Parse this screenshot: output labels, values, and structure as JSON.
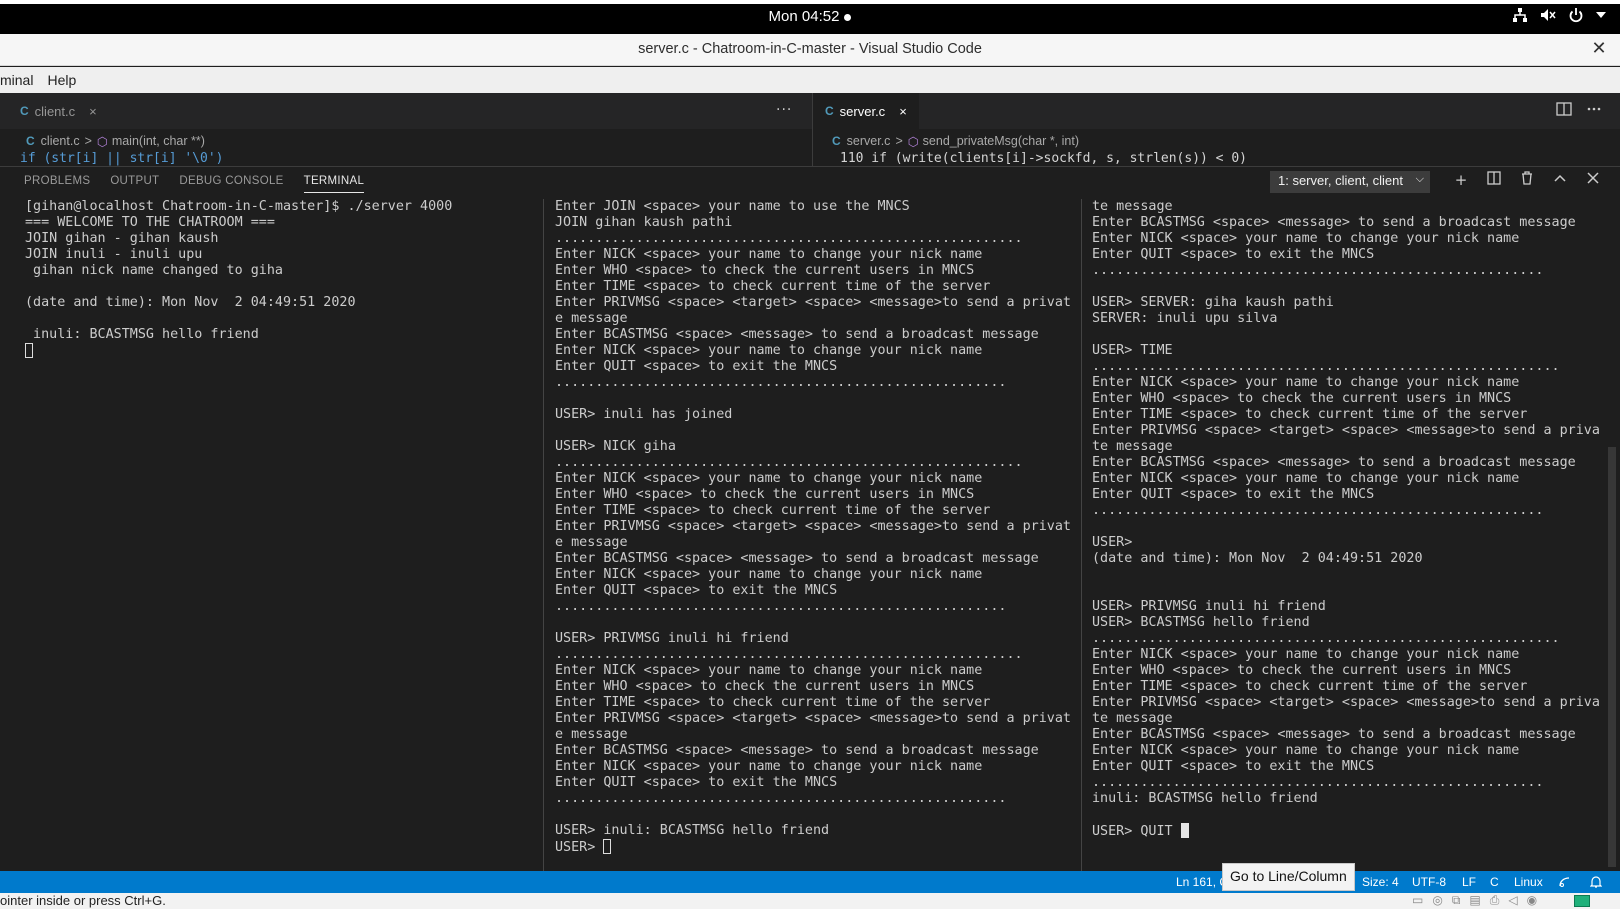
{
  "system": {
    "clock": "Mon 04:52",
    "icons": [
      "network-icon",
      "volume-muted-icon",
      "power-icon",
      "dropdown-arrow-icon"
    ]
  },
  "window": {
    "title": "server.c - Chatroom-in-C-master - Visual Studio Code",
    "close": "✕"
  },
  "menu": [
    "minal",
    "Help"
  ],
  "editors": {
    "left": {
      "tab_label": "client.c",
      "tab_close": "×",
      "more": "···",
      "breadcrumb_file": "client.c",
      "breadcrumb_symbol": "main(int, char **)",
      "peek_line": "       if (str[i]  ||  str[i]    '\\0')"
    },
    "right": {
      "tab_label": "server.c",
      "tab_close": "×",
      "breadcrumb_file": "server.c",
      "breadcrumb_symbol": "send_privateMsg(char *, int)",
      "peek_line": "110                 if (write(clients[i]->sockfd, s, strlen(s)) < 0)"
    },
    "icon_letter": "C",
    "chevron": ">"
  },
  "panel": {
    "tabs": [
      "PROBLEMS",
      "OUTPUT",
      "DEBUG CONSOLE",
      "TERMINAL"
    ],
    "active_tab": "TERMINAL",
    "terminal_select": "1: server, client, client",
    "actions": [
      "plus-icon",
      "split-icon",
      "trash-icon",
      "chevron-up-icon",
      "close-icon"
    ]
  },
  "terminals": {
    "server": [
      "[gihan@localhost Chatroom-in-C-master]$ ./server 4000",
      "=== WELCOME TO THE CHATROOM ===",
      "JOIN gihan - gihan kaush",
      "JOIN inuli - inuli upu",
      " gihan nick name changed to giha",
      "",
      "(date and time): Mon Nov  2 04:49:51 2020",
      "",
      " inuli: BCASTMSG hello friend"
    ],
    "client1": [
      "Enter JOIN <space> your name to use the MNCS",
      "JOIN gihan kaush pathi",
      "..........................................................",
      "Enter NICK <space> your name to change your nick name",
      "Enter WHO <space> to check the current users in MNCS",
      "Enter TIME <space> to check current time of the server",
      "Enter PRIVMSG <space> <target> <space> <message>to send a privat",
      "e message",
      "Enter BCASTMSG <space> <message> to send a broadcast message",
      "Enter NICK <space> your name to change your nick name",
      "Enter QUIT <space> to exit the MNCS",
      "........................................................",
      "",
      "USER> inuli has joined",
      "",
      "USER> NICK giha",
      "..........................................................",
      "Enter NICK <space> your name to change your nick name",
      "Enter WHO <space> to check the current users in MNCS",
      "Enter TIME <space> to check current time of the server",
      "Enter PRIVMSG <space> <target> <space> <message>to send a privat",
      "e message",
      "Enter BCASTMSG <space> <message> to send a broadcast message",
      "Enter NICK <space> your name to change your nick name",
      "Enter QUIT <space> to exit the MNCS",
      "........................................................",
      "",
      "USER> PRIVMSG inuli hi friend",
      "..........................................................",
      "Enter NICK <space> your name to change your nick name",
      "Enter WHO <space> to check the current users in MNCS",
      "Enter TIME <space> to check current time of the server",
      "Enter PRIVMSG <space> <target> <space> <message>to send a privat",
      "e message",
      "Enter BCASTMSG <space> <message> to send a broadcast message",
      "Enter NICK <space> your name to change your nick name",
      "Enter QUIT <space> to exit the MNCS",
      "........................................................",
      "",
      "USER> inuli: BCASTMSG hello friend"
    ],
    "client1_prompt": "USER> ",
    "client2": [
      "te message",
      "Enter BCASTMSG <space> <message> to send a broadcast message",
      "Enter NICK <space> your name to change your nick name",
      "Enter QUIT <space> to exit the MNCS",
      "........................................................",
      "",
      "USER> SERVER: giha kaush pathi",
      "SERVER: inuli upu silva",
      "",
      "USER> TIME",
      "..........................................................",
      "Enter NICK <space> your name to change your nick name",
      "Enter WHO <space> to check the current users in MNCS",
      "Enter TIME <space> to check current time of the server",
      "Enter PRIVMSG <space> <target> <space> <message>to send a priva",
      "te message",
      "Enter BCASTMSG <space> <message> to send a broadcast message",
      "Enter NICK <space> your name to change your nick name",
      "Enter QUIT <space> to exit the MNCS",
      "........................................................",
      "",
      "USER>",
      "(date and time): Mon Nov  2 04:49:51 2020",
      "",
      "",
      "USER> PRIVMSG inuli hi friend",
      "USER> BCASTMSG hello friend",
      "..........................................................",
      "Enter NICK <space> your name to change your nick name",
      "Enter WHO <space> to check the current users in MNCS",
      "Enter TIME <space> to check current time of the server",
      "Enter PRIVMSG <space> <target> <space> <message>to send a priva",
      "te message",
      "Enter BCASTMSG <space> <message> to send a broadcast message",
      "Enter NICK <space> your name to change your nick name",
      "Enter QUIT <space> to exit the MNCS",
      "........................................................",
      "inuli: BCASTMSG hello friend",
      ""
    ],
    "client2_prompt": "USER> QUIT "
  },
  "statusbar": {
    "position": "Ln 161, C",
    "tab_size": "Size: 4",
    "encoding": "UTF-8",
    "eol": "LF",
    "language": "C",
    "os": "Linux",
    "tooltip": "Go to Line/Column"
  },
  "host": {
    "hint": "ointer inside or press Ctrl+G."
  },
  "colors": {
    "status_bar": "#007acc",
    "terminal_bg": "#1e1e1e",
    "accent_green": "#1fb07a"
  }
}
